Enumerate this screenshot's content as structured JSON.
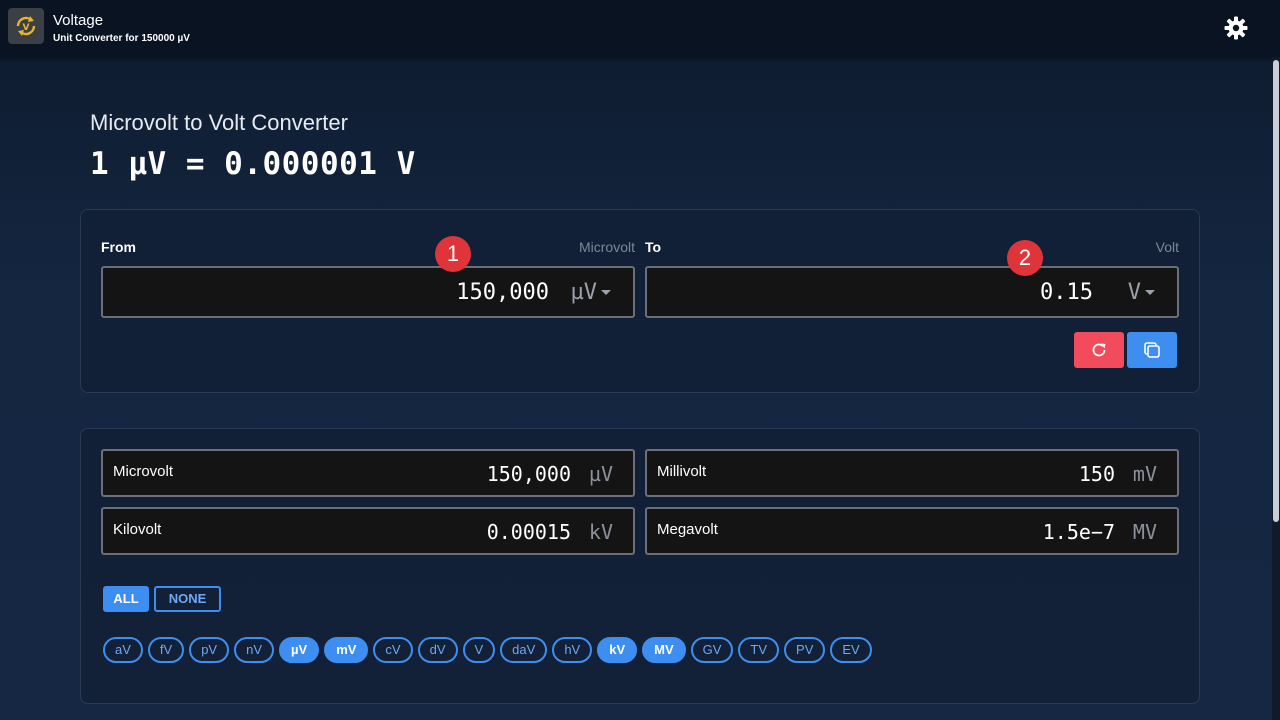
{
  "header": {
    "app_title": "Voltage",
    "app_subtitle": "Unit Converter for 150000 µV",
    "app_icon": "refresh-volt-icon",
    "settings_icon": "gear-icon"
  },
  "converter": {
    "title": "Microvolt to Volt Converter",
    "formula": "1 µV = 0.000001 V",
    "from": {
      "label": "From",
      "unit_name": "Microvolt",
      "value": "150,000",
      "unit": "µV",
      "badge": "1"
    },
    "to": {
      "label": "To",
      "unit_name": "Volt",
      "value": "0.15",
      "unit": "V",
      "badge": "2"
    },
    "reset_icon": "reset-icon",
    "copy_icon": "copy-icon"
  },
  "results": [
    {
      "name": "Microvolt",
      "value": "150,000",
      "unit": "µV"
    },
    {
      "name": "Millivolt",
      "value": "150",
      "unit": "mV"
    },
    {
      "name": "Kilovolt",
      "value": "0.00015",
      "unit": "kV"
    },
    {
      "name": "Megavolt",
      "value": "1.5e−7",
      "unit": "MV"
    }
  ],
  "selection": {
    "all_label": "ALL",
    "none_label": "NONE"
  },
  "chips": [
    {
      "label": "aV",
      "on": false
    },
    {
      "label": "fV",
      "on": false
    },
    {
      "label": "pV",
      "on": false
    },
    {
      "label": "nV",
      "on": false
    },
    {
      "label": "µV",
      "on": true
    },
    {
      "label": "mV",
      "on": true
    },
    {
      "label": "cV",
      "on": false
    },
    {
      "label": "dV",
      "on": false
    },
    {
      "label": "V",
      "on": false
    },
    {
      "label": "daV",
      "on": false
    },
    {
      "label": "hV",
      "on": false
    },
    {
      "label": "kV",
      "on": true
    },
    {
      "label": "MV",
      "on": true
    },
    {
      "label": "GV",
      "on": false
    },
    {
      "label": "TV",
      "on": false
    },
    {
      "label": "PV",
      "on": false
    },
    {
      "label": "EV",
      "on": false
    }
  ],
  "colors": {
    "accent": "#3d8ef0",
    "reset": "#f24b5b",
    "badge": "#e0343b",
    "background": "#142640"
  }
}
